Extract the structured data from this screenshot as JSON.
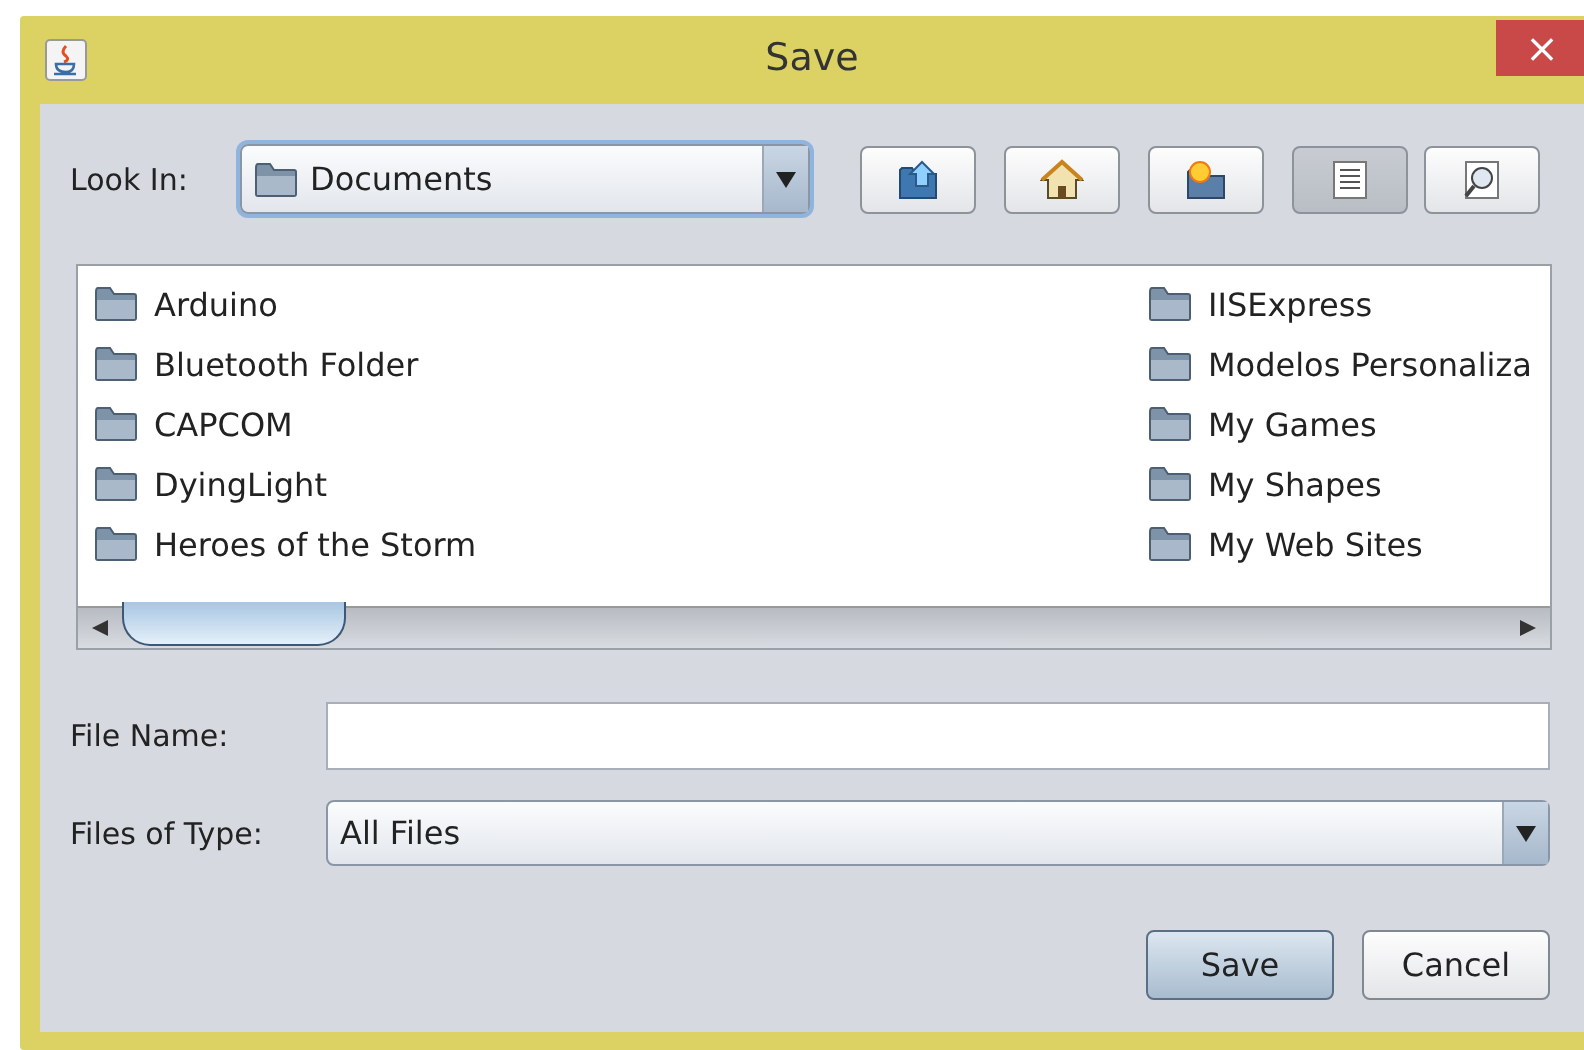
{
  "window": {
    "title": "Save",
    "close": "×"
  },
  "look_in": {
    "label": "Look In:",
    "value": "Documents"
  },
  "toolbar": [
    {
      "kind": "up",
      "selected": false
    },
    {
      "kind": "home",
      "selected": false
    },
    {
      "kind": "new-folder",
      "selected": false
    },
    {
      "kind": "list",
      "selected": true
    },
    {
      "kind": "details",
      "selected": false
    }
  ],
  "files": [
    {
      "name": "Arduino"
    },
    {
      "name": "Bluetooth Folder"
    },
    {
      "name": "CAPCOM"
    },
    {
      "name": "DyingLight"
    },
    {
      "name": "Heroes of the Storm"
    },
    {
      "name": "IISExpress"
    },
    {
      "name": "Modelos Personaliza"
    },
    {
      "name": "My Games"
    },
    {
      "name": "My Shapes"
    },
    {
      "name": "My Web Sites"
    }
  ],
  "file_name": {
    "label": "File Name:"
  },
  "files_of_type": {
    "label": "Files of Type:",
    "value": "All Files"
  },
  "buttons": [
    {
      "label": "Save",
      "default": true
    },
    {
      "label": "Cancel",
      "default": false
    }
  ]
}
